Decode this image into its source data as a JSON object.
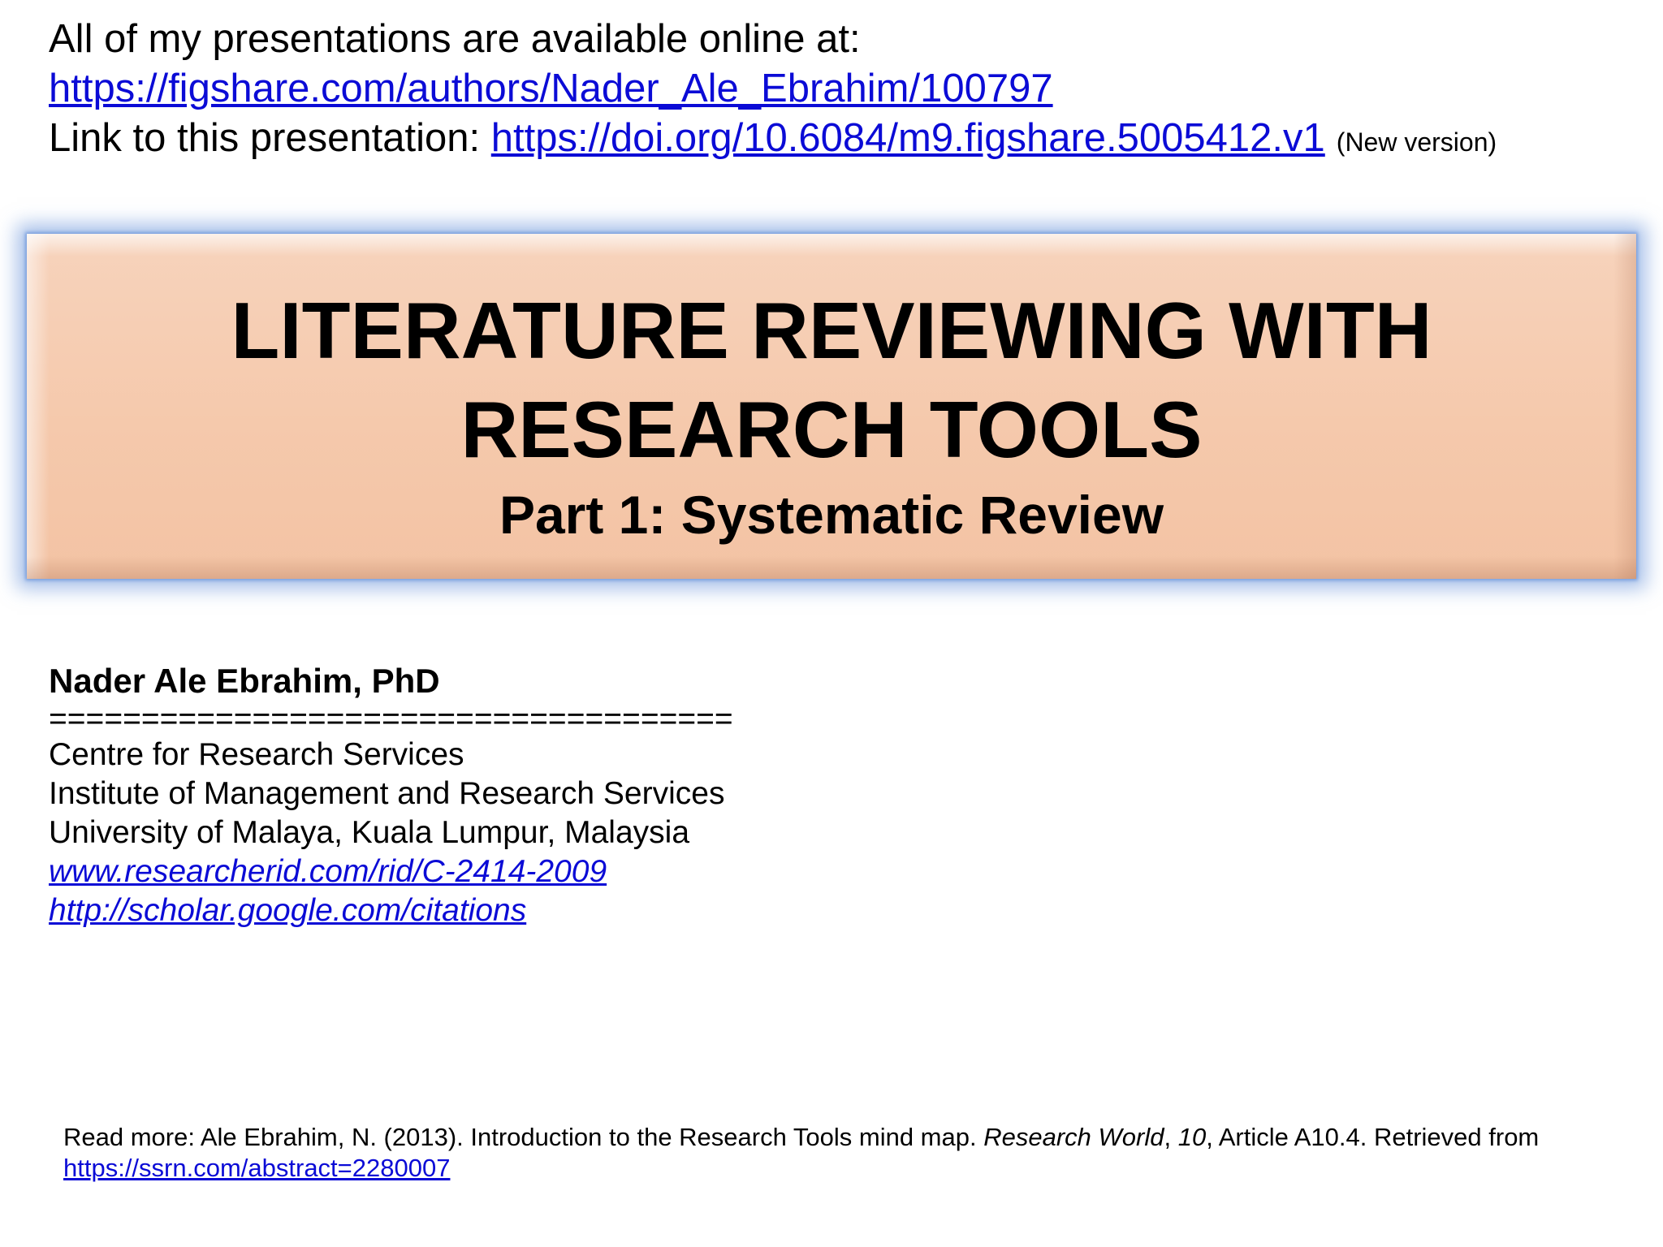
{
  "header": {
    "line1": "All of my presentations are available online at:",
    "profile_link": "https://figshare.com/authors/Nader_Ale_Ebrahim/100797",
    "line3_prefix": "Link to this presentation: ",
    "presentation_link": "https://doi.org/10.6084/m9.figshare.5005412.v1",
    "version_note": "(New version)"
  },
  "title": {
    "main_line1": "LITERATURE REVIEWING WITH",
    "main_line2": "RESEARCH TOOLS",
    "subtitle": "Part 1: Systematic Review"
  },
  "author": {
    "name": "Nader Ale Ebrahim, PhD",
    "separator": "=====================================",
    "affiliation_1": "Centre for Research Services",
    "affiliation_2": "Institute of Management and Research Services",
    "affiliation_3": "University of Malaya, Kuala Lumpur, Malaysia",
    "researcherid_link": "www.researcherid.com/rid/C-2414-2009",
    "scholar_link": "http://scholar.google.com/citations"
  },
  "footer": {
    "citation_prefix": "Read more: Ale Ebrahim, N. (2013). Introduction to the Research Tools mind map. ",
    "journal": "Research World",
    "separator_1": ", ",
    "volume": "10",
    "citation_suffix": ", Article A10.4. Retrieved from",
    "ssrn_link": "https://ssrn.com/abstract=2280007"
  },
  "colors": {
    "link": "#0b0bd6",
    "title_box": "#f5c9ac",
    "title_glow": "#5f8cd7"
  }
}
